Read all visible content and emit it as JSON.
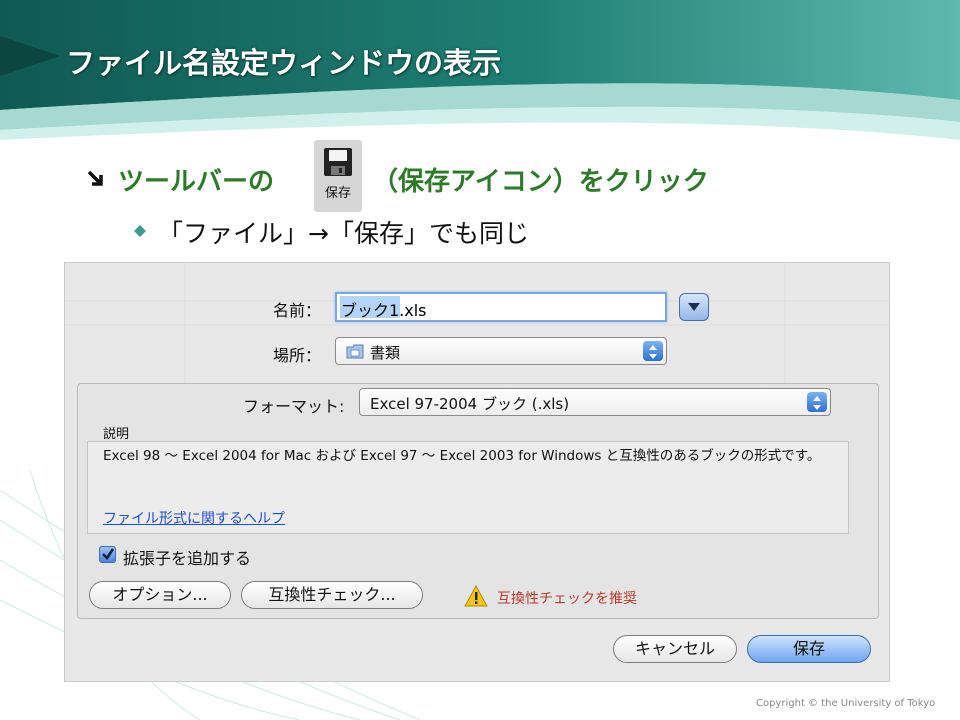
{
  "slide": {
    "title": "ファイル名設定ウィンドウの表示",
    "bullet1_pre": "ツールバーの",
    "save_icon_label": "保存",
    "bullet1_post": "（保存アイコン）をクリック",
    "bullet2": "「ファイル」→「保存」でも同じ",
    "copyright": "Copyright © the University of Tokyo"
  },
  "dialog": {
    "name_label": "名前：",
    "name_value": "ブック1.xls",
    "location_label": "場所：",
    "location_value": "書類",
    "format_label": "フォーマット:",
    "format_value": "Excel 97-2004 ブック (.xls)",
    "desc_label": "説明",
    "desc_text": "Excel 98 〜 Excel 2004 for Mac および Excel 97 〜 Excel 2003 for Windows と互換性のあるブックの形式です。",
    "help_link": "ファイル形式に関するヘルプ",
    "extension_checkbox": "拡張子を追加する",
    "extension_checked": true,
    "options_button": "オプション...",
    "compat_button": "互換性チェック...",
    "warning_text": "互換性チェックを推奨",
    "cancel_button": "キャンセル",
    "save_button": "保存"
  },
  "icons": [
    "slide-bullet-arrow-icon",
    "diamond-bullet-icon",
    "save-floppy-icon",
    "expand-arrow-icon",
    "folder-icon",
    "popup-stepper-icon",
    "checkbox-icon",
    "warning-icon"
  ],
  "colors": {
    "title_text": "#ffffff",
    "bullet_green": "#2e7a2a",
    "link": "#1f4fd6",
    "warning": "#c0392b",
    "accent_blue": "#6fa6ef"
  }
}
